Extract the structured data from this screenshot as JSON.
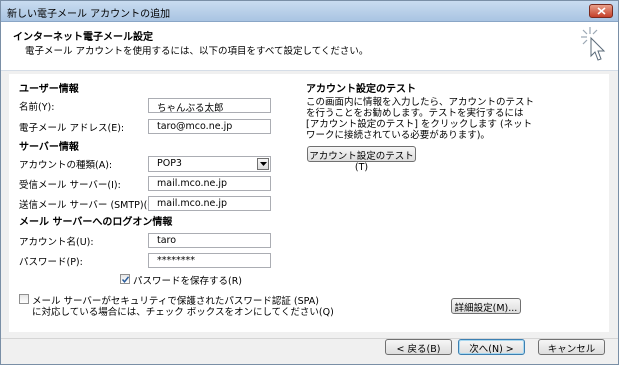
{
  "window": {
    "title": "新しい電子メール アカウントの追加"
  },
  "header": {
    "title": "インターネット電子メール設定",
    "subtitle": "電子メール アカウントを使用するには、以下の項目をすべて設定してください。"
  },
  "user_info": {
    "heading": "ユーザー情報",
    "name_label": "名前(Y):",
    "name_value": "ちゃんぷる太郎",
    "email_label": "電子メール アドレス(E):",
    "email_value": "taro@mco.ne.jp"
  },
  "server_info": {
    "heading": "サーバー情報",
    "account_type_label": "アカウントの種類(A):",
    "account_type_value": "POP3",
    "incoming_label": "受信メール サーバー(I):",
    "incoming_value": "mail.mco.ne.jp",
    "outgoing_label": "送信メール サーバー (SMTP)(O):",
    "outgoing_value": "mail.mco.ne.jp"
  },
  "logon_info": {
    "heading": "メール サーバーへのログオン情報",
    "account_name_label": "アカウント名(U):",
    "account_name_value": "taro",
    "password_label": "パスワード(P):",
    "password_value": "********",
    "save_password_label": "パスワードを保存する(R)",
    "save_password_checked": true,
    "spa_label_line1": "メール サーバーがセキュリティで保護されたパスワード認証 (SPA)",
    "spa_label_line2": "に対応している場合には、チェック ボックスをオンにしてください(Q)",
    "spa_checked": false
  },
  "test": {
    "heading": "アカウント設定のテスト",
    "description": "この画面内に情報を入力したら、アカウントのテストを行うことをお勧めします。テストを実行するには [アカウント設定のテスト] をクリックします (ネットワークに接続されている必要があります)。",
    "test_button": "アカウント設定のテスト(T)",
    "more_settings_button": "詳細設定(M)..."
  },
  "footer": {
    "back_button": "< 戻る(B)",
    "next_button": "次へ(N) >",
    "cancel_button": "キャンセル"
  }
}
